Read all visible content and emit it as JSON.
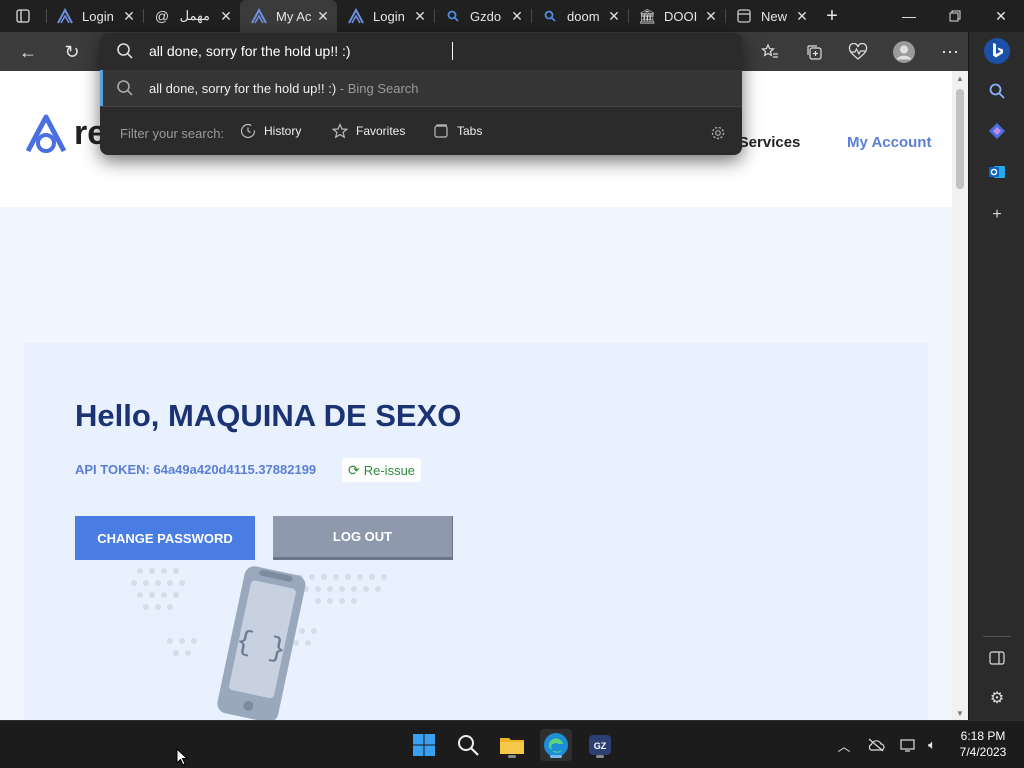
{
  "browser": {
    "tabs": [
      {
        "title": "Login",
        "favicon": "logo-a-icon",
        "active": false
      },
      {
        "title": "مهمل",
        "favicon": "at-icon",
        "active": false
      },
      {
        "title": "My Ac",
        "favicon": "logo-a-icon",
        "active": true
      },
      {
        "title": "Login",
        "favicon": "logo-a-icon",
        "active": false
      },
      {
        "title": "Gzdo",
        "favicon": "search-icon",
        "active": false
      },
      {
        "title": "doom",
        "favicon": "search-icon",
        "active": false
      },
      {
        "title": "DOOI",
        "favicon": "bank-icon",
        "active": false
      },
      {
        "title": "New",
        "favicon": "newtab-icon",
        "active": false
      }
    ],
    "omnibox": {
      "value": "all done, sorry for the hold up!! :)",
      "suggestion_text": "all done, sorry for the hold up!! :)",
      "suggestion_source": " - Bing Search",
      "filter_label": "Filter your search:",
      "filters": [
        "History",
        "Favorites",
        "Tabs"
      ]
    }
  },
  "site": {
    "logo_text": "re",
    "nav": {
      "services": "al Services",
      "account": "My Account"
    },
    "greeting": "Hello, MAQUINA DE SEXO",
    "api_token_label": "API TOKEN: 64a49a420d4115.37882199",
    "reissue_label": "Re-issue",
    "change_password_label": "CHANGE PASSWORD",
    "logout_label": "LOG OUT"
  },
  "taskbar": {
    "time": "6:18 PM",
    "date": "7/4/2023"
  },
  "colors": {
    "primary_button": "#4a7de3",
    "secondary_button": "#8e99ad",
    "heading": "#1c3373",
    "accent": "#5b7fd6",
    "reissue_green": "#2e8b3e"
  }
}
